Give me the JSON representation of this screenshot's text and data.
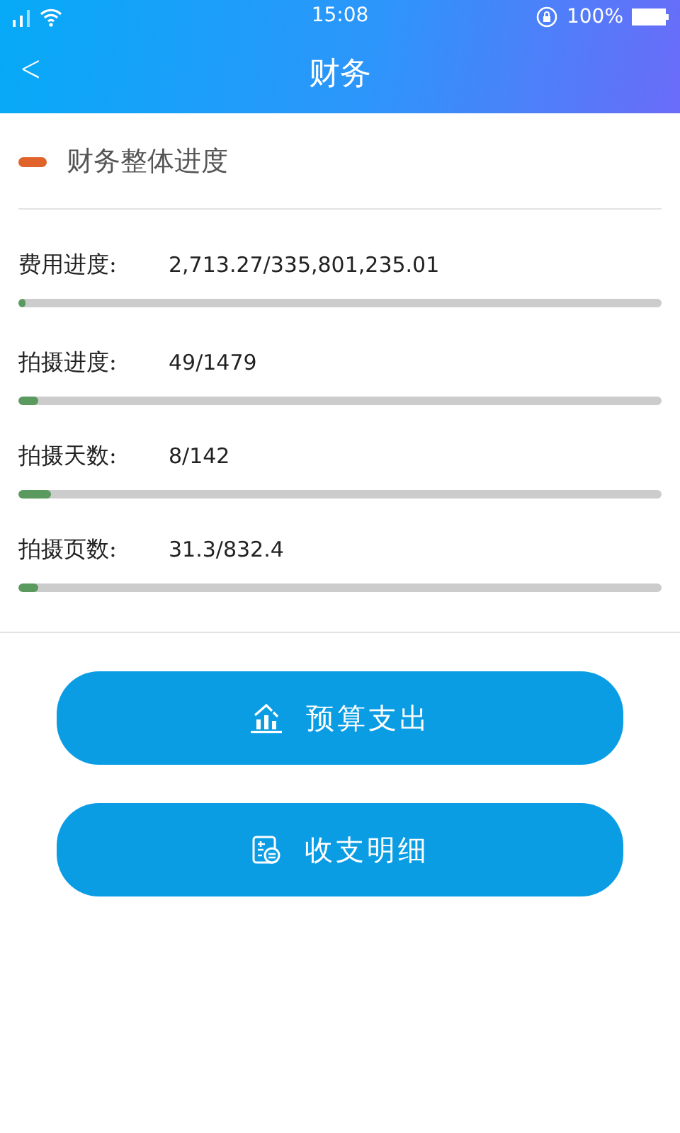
{
  "status_bar": {
    "time": "15:08",
    "battery": "100%"
  },
  "header": {
    "back": "<",
    "title": "财务"
  },
  "section": {
    "title": "财务整体进度"
  },
  "progress": [
    {
      "label": "费用进度:",
      "value": "2,713.27/335,801,235.01",
      "level": 0.01
    },
    {
      "label": "拍摄进度:",
      "value": "49/1479",
      "level": 0.03
    },
    {
      "label": "拍摄天数:",
      "value": "8/142",
      "level": 0.05
    },
    {
      "label": "拍摄页数:",
      "value": "31.3/832.4",
      "level": 0.03
    }
  ],
  "buttons": [
    {
      "kind": "chart",
      "label": "预算支出"
    },
    {
      "kind": "ledger",
      "label": "收支明细"
    }
  ]
}
